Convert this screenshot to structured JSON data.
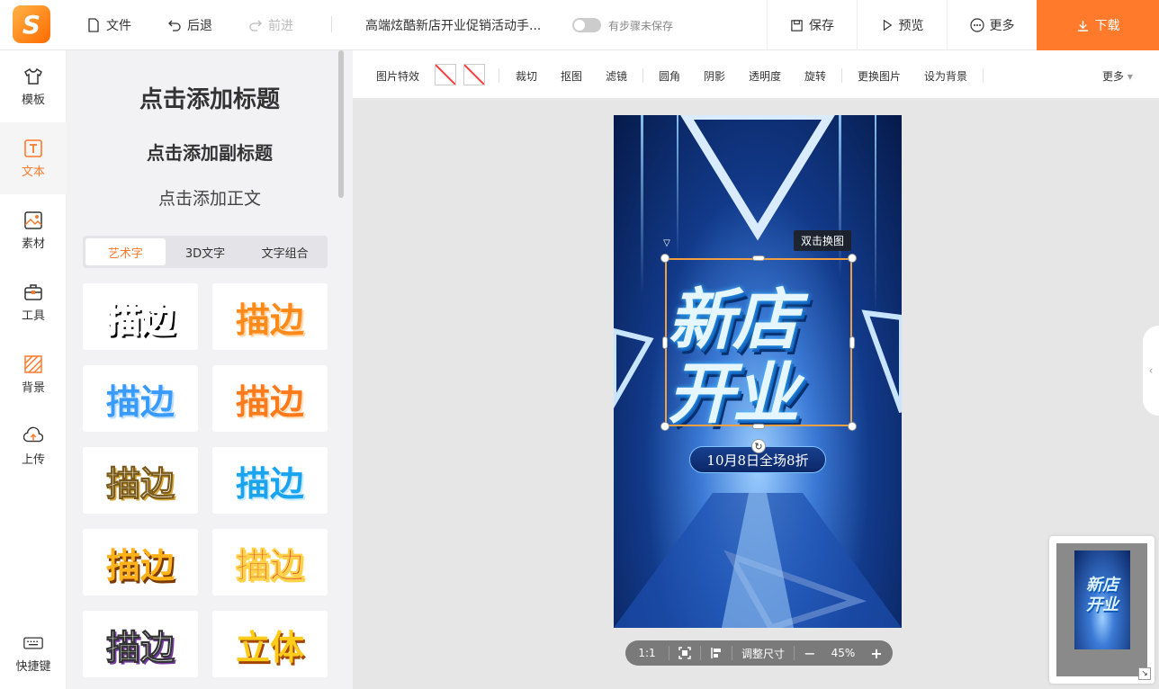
{
  "header": {
    "file": "文件",
    "undo": "后退",
    "redo": "前进",
    "doc_title": "高端炫酷新店开业促销活动手...",
    "save_status": "有步骤未保存",
    "save": "保存",
    "preview": "预览",
    "more": "更多",
    "download": "下载"
  },
  "sidebar": {
    "items": [
      {
        "label": "模板",
        "icon": "shirt-icon"
      },
      {
        "label": "文本",
        "icon": "text-icon"
      },
      {
        "label": "素材",
        "icon": "image-icon"
      },
      {
        "label": "工具",
        "icon": "toolbox-icon"
      },
      {
        "label": "背景",
        "icon": "background-icon"
      },
      {
        "label": "上传",
        "icon": "cloud-upload-icon"
      }
    ],
    "shortcut": "快捷键"
  },
  "panel": {
    "add_title": "点击添加标题",
    "add_subtitle": "点击添加副标题",
    "add_body": "点击添加正文",
    "tabs": [
      "艺术字",
      "3D文字",
      "文字组合"
    ],
    "art_text": [
      "描边",
      "描边",
      "描边",
      "描边",
      "描边",
      "描边",
      "描边",
      "描边",
      "描边",
      "立体"
    ]
  },
  "image_toolbar": {
    "effects": "图片特效",
    "crop": "裁切",
    "cutout": "抠图",
    "filter": "滤镜",
    "round": "圆角",
    "shadow": "阴影",
    "opacity": "透明度",
    "rotate": "旋转",
    "replace": "更换图片",
    "set_bg": "设为背景",
    "more": "更多"
  },
  "poster": {
    "headline_line1": "新店",
    "headline_line2": "开业",
    "promo": "10月8日全场8折",
    "tooltip": "双击换图"
  },
  "zoom": {
    "ratio": "1:1",
    "resize": "调整尺寸",
    "minus": "−",
    "level": "45%",
    "plus": "+"
  },
  "colors": {
    "accent": "#ff7a2b"
  }
}
